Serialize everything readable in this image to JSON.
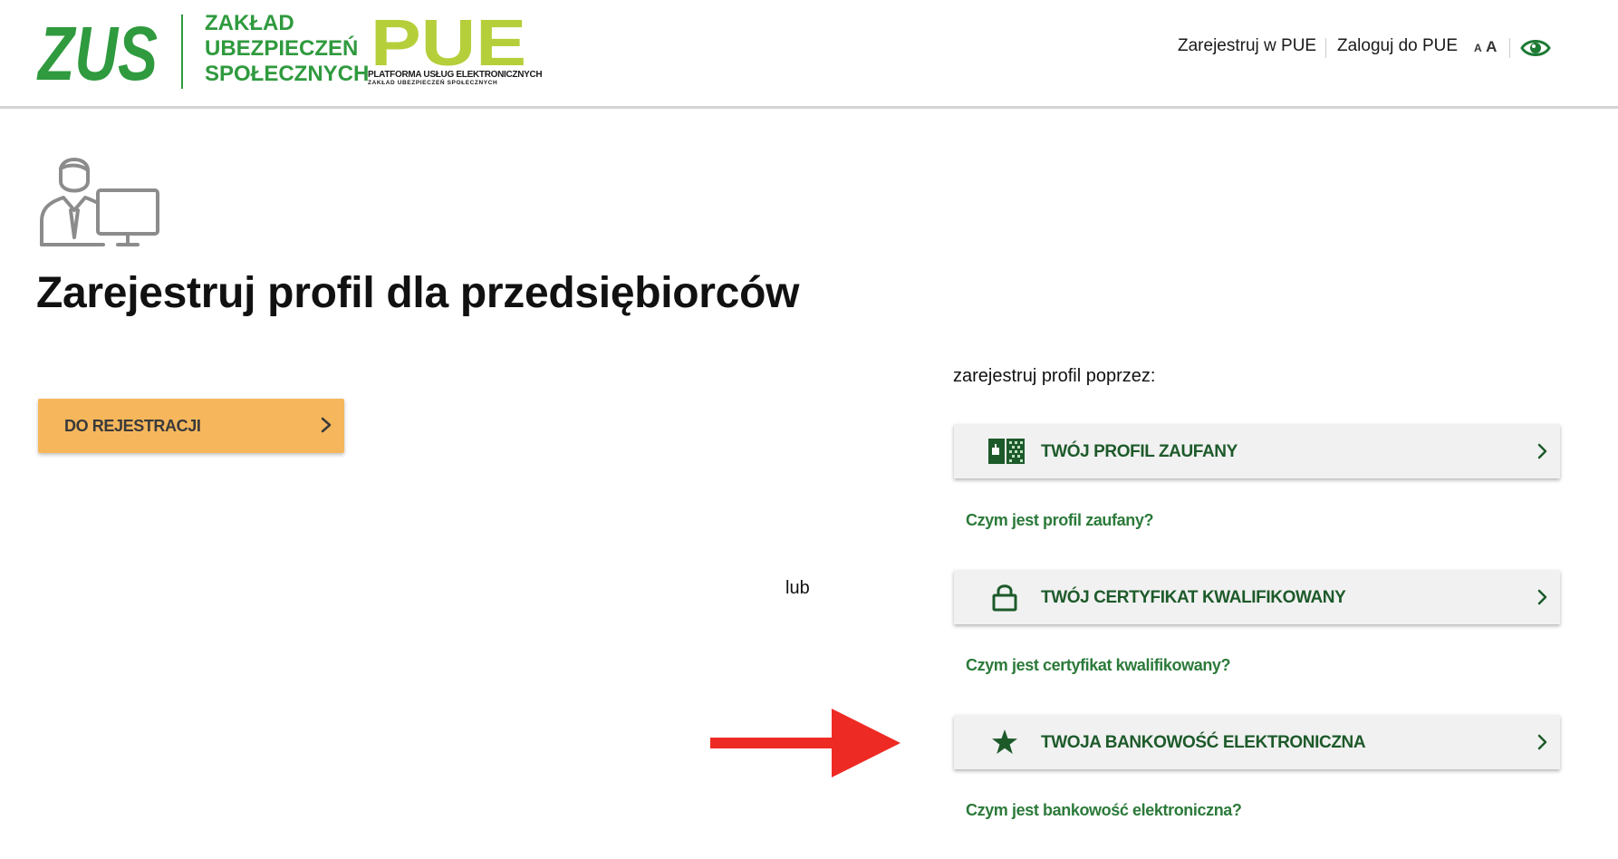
{
  "header": {
    "zus_logo_text": "ZUS",
    "org_name": [
      "ZAKŁAD",
      "UBEZPIECZEŃ",
      "SPOŁECZNYCH"
    ],
    "pue_logo_text": "PUE",
    "pue_subtitle": "PLATFORMA USŁUG ELEKTRONICZNYCH",
    "pue_subtitle_small": "ZAKŁAD UBEZPIECZEŃ SPOŁECZNYCH",
    "nav": {
      "register": "Zarejestruj w PUE",
      "login": "Zaloguj do PUE",
      "font_small": "A",
      "font_large": "A"
    },
    "icons": {
      "contrast": "eye-icon"
    }
  },
  "main": {
    "icon": "user-computer-icon",
    "title": "Zarejestruj profil dla przedsiębiorców",
    "register_button": "DO REJESTRACJI",
    "or_label": "lub",
    "via_label": "zarejestruj profil poprzez:",
    "options": [
      {
        "label": "TWÓJ PROFIL ZAUFANY",
        "icon": "trusted-profile-icon",
        "help": "Czym jest profil zaufany?"
      },
      {
        "label": "TWÓJ CERTYFIKAT KWALIFIKOWANY",
        "icon": "padlock-icon",
        "help": "Czym jest certyfikat kwalifikowany?"
      },
      {
        "label": "TWOJA BANKOWOŚĆ ELEKTRONICZNA",
        "icon": "star-icon",
        "help": "Czym jest bankowość elektroniczna?"
      }
    ]
  },
  "colors": {
    "zus_green": "#2f9a3e",
    "pue_lime": "#b5cf3a",
    "dark_green_text": "#1d5a2a",
    "link_green": "#2c7a3a",
    "button_orange": "#f6b75c",
    "card_bg": "#f1f1f1",
    "arrow_red": "#ee2a24"
  }
}
